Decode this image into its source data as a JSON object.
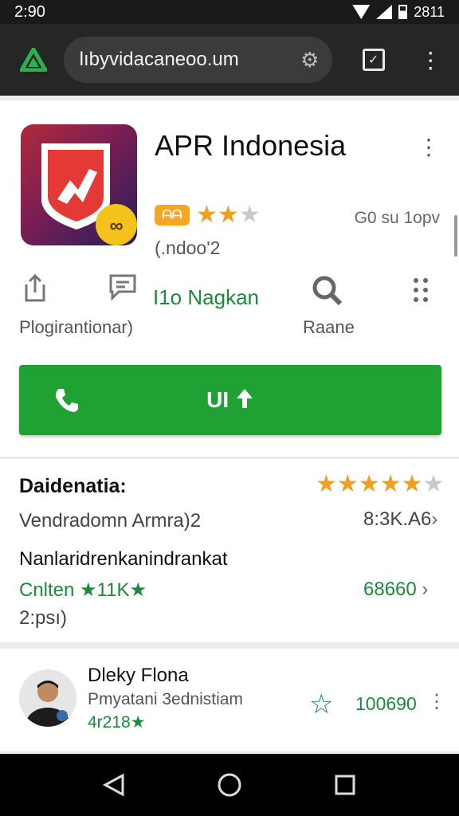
{
  "status_bar": {
    "time": "2:90",
    "right_text": "2811"
  },
  "browser": {
    "url": "lıbyvidacaneoo.um"
  },
  "app": {
    "name": "APR Indonesia",
    "badge": "ᗩᗩ",
    "stars_on": "★★",
    "stars_off": "★",
    "downloads": "G0 su 1opv",
    "subtitle": "(.ndoo'2",
    "link_green": "I1o Nagkan",
    "action_left_label": "Plogirantionar)",
    "action_right_label": "Raane",
    "primary_button_label": "UI"
  },
  "details": {
    "section_title": "Daidenatia:",
    "section_stars_on": "★★★★★",
    "section_star_off": "★",
    "row1_left": "Vendradomn Armra)2",
    "row1_right": "8:3K.A6",
    "row2_title": "Nanlaridrenkanindrankat",
    "row2_green": "Cnlten ★11K★",
    "row2_right": "68660",
    "row2_sub": "2:psı)",
    "chevron": "›"
  },
  "review": {
    "name": "Dleky Flona",
    "subtitle": "Pmyatani 3ednistiam",
    "rating": "4r218★",
    "count": "100690"
  },
  "colors": {
    "green": "#1fa233",
    "star": "#f0a020",
    "icon_red": "#e53935"
  },
  "icons": [
    "app-logo-icon",
    "gear-icon",
    "tab-switcher-icon",
    "overflow-menu-icon",
    "share-icon",
    "comment-icon",
    "search-icon",
    "apps-grid-icon",
    "phone-icon",
    "upload-icon",
    "star-outline-icon",
    "back-nav-icon",
    "home-nav-icon",
    "recents-nav-icon"
  ]
}
